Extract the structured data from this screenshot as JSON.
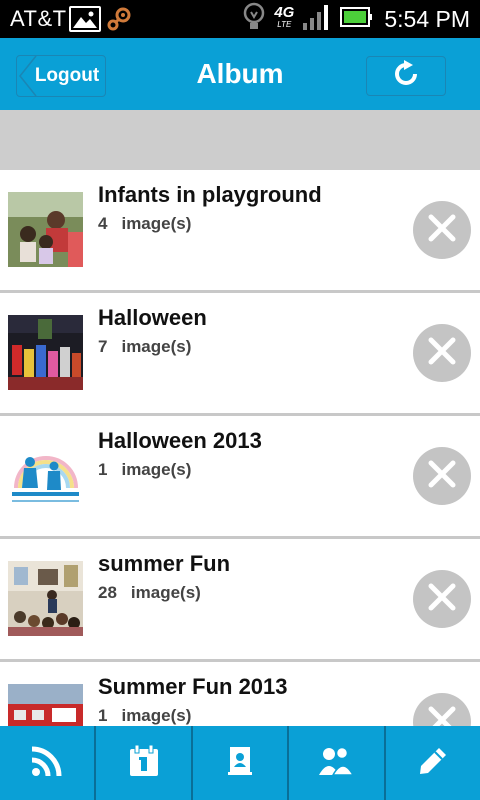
{
  "status_bar": {
    "carrier": "AT&T",
    "network": "4G",
    "network_sub": "LTE",
    "time": "5:54 PM"
  },
  "header": {
    "logout_label": "Logout",
    "title": "Album",
    "refresh_icon": "refresh-icon"
  },
  "albums": [
    {
      "title": "Infants in playground",
      "count": "4",
      "count_label": "image(s)"
    },
    {
      "title": "Halloween",
      "count": "7",
      "count_label": "image(s)"
    },
    {
      "title": "Halloween 2013",
      "count": "1",
      "count_label": "image(s)"
    },
    {
      "title": "summer Fun",
      "count": "28",
      "count_label": "image(s)"
    },
    {
      "title": "Summer Fun 2013",
      "count": "1",
      "count_label": "image(s)"
    }
  ],
  "tabs": [
    {
      "icon": "rss-feed-icon"
    },
    {
      "icon": "calendar-icon"
    },
    {
      "icon": "contacts-book-icon"
    },
    {
      "icon": "people-icon"
    },
    {
      "icon": "pencil-icon"
    }
  ],
  "colors": {
    "accent": "#0aa0d6",
    "band": "#cdcdcd",
    "delete": "#c4c4c4"
  }
}
